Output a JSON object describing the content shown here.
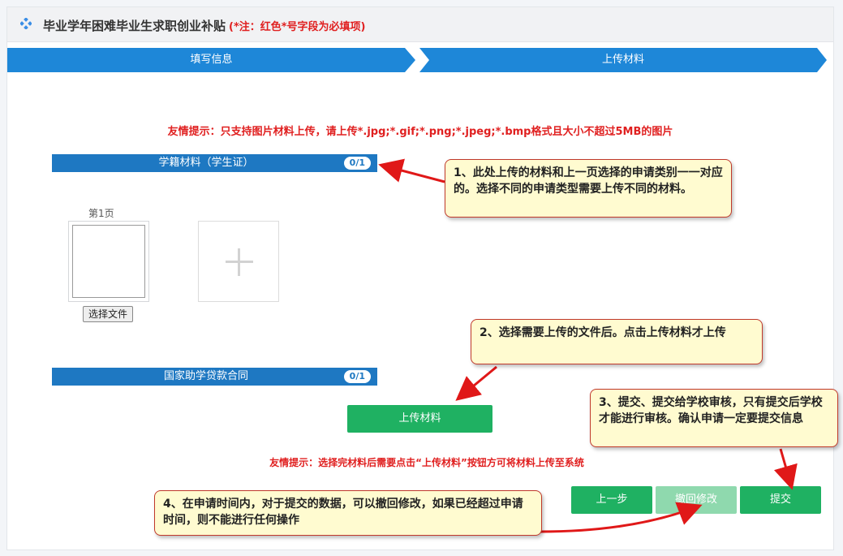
{
  "header": {
    "title": "毕业学年困难毕业生求职创业补贴",
    "note": "(*注：红色*号字段为必填项)",
    "icon": "diamond-icon"
  },
  "steps": [
    {
      "label": "填写信息"
    },
    {
      "label": "上传材料"
    }
  ],
  "tips": {
    "top": "友情提示：只支持图片材料上传，请上传*.jpg;*.gif;*.png;*.jpeg;*.bmp格式且大小不超过5MB的图片",
    "bottom": "友情提示：选择完材料后需要点击“上传材料”按钮方可将材料上传至系统"
  },
  "sections": [
    {
      "title": "学籍材料（学生证）",
      "count": "0/1"
    },
    {
      "title": "国家助学贷款合同",
      "count": "0/1"
    }
  ],
  "upload": {
    "page_label": "第1页",
    "choose_file": "选择文件"
  },
  "buttons": {
    "upload": "上传材料",
    "prev": "上一步",
    "withdraw": "撤回修改",
    "submit": "提交"
  },
  "callouts": {
    "c1": "1、此处上传的材料和上一页选择的申请类别一一对应的。选择不同的申请类型需要上传不同的材料。",
    "c2": "2、选择需要上传的文件后。点击上传材料才上传",
    "c3": "3、提交、提交给学校审核，只有提交后学校才能进行审核。确认申请一定要提交信息",
    "c4": "4、在申请时间内，对于提交的数据，可以撤回修改，如果已经超过申请时间，则不能进行任何操作"
  },
  "colors": {
    "step_blue": "#1e87d8",
    "section_blue": "#1e78c2",
    "green": "#1fb162",
    "tip_red": "#e02020"
  }
}
